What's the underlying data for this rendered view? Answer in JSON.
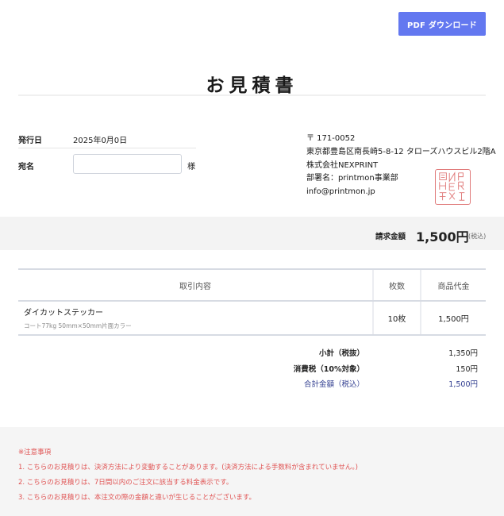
{
  "toolbar": {
    "pdf_download_label": "PDF ダウンロード"
  },
  "document": {
    "title": "お見積書"
  },
  "issue": {
    "date_label": "発行日",
    "date_value": "2025年0月0日"
  },
  "addressee": {
    "label": "宛名",
    "input_value": "",
    "suffix": "様"
  },
  "company": {
    "postal": "〒 171-0052",
    "address": "東京都豊島区南長崎5-8-12 タローズハウスビル2階A",
    "name": "株式会社NEXPRINT",
    "department": "部署名：printmon事業部",
    "email": "info@printmon.jp",
    "seal_text": "NEXPRINT"
  },
  "billing": {
    "label": "請求金額",
    "amount": "1,500円",
    "tax_note": "(税込)"
  },
  "table": {
    "headers": [
      "取引内容",
      "枚数",
      "商品代金"
    ],
    "rows": [
      {
        "name": "ダイカットステッカー",
        "detail": "コート77kg 50mm×50mm片面カラー",
        "quantity": "10枚",
        "price": "1,500円"
      }
    ]
  },
  "totals": {
    "subtotal_label": "小計（税抜）",
    "subtotal_value": "1,350円",
    "tax_label": "消費税（10%対象）",
    "tax_value": "150円",
    "grand_label": "合計金額（税込）",
    "grand_value": "1,500円"
  },
  "notes": {
    "heading": "※注意事項",
    "items": [
      "1. こちらのお見積りは、決済方法により変動することがあります。(決済方法による手数料が含まれていません。)",
      "2. こちらのお見積りは、7日間以内のご注文に該当する料金表示です。",
      "3. こちらのお見積りは、本注文の際の金額と違いが生じることがございます。"
    ]
  },
  "colors": {
    "accent": "#6378f0",
    "seal": "#e07a7a",
    "notes": "#e05252",
    "grand_total": "#2f3c8f"
  }
}
